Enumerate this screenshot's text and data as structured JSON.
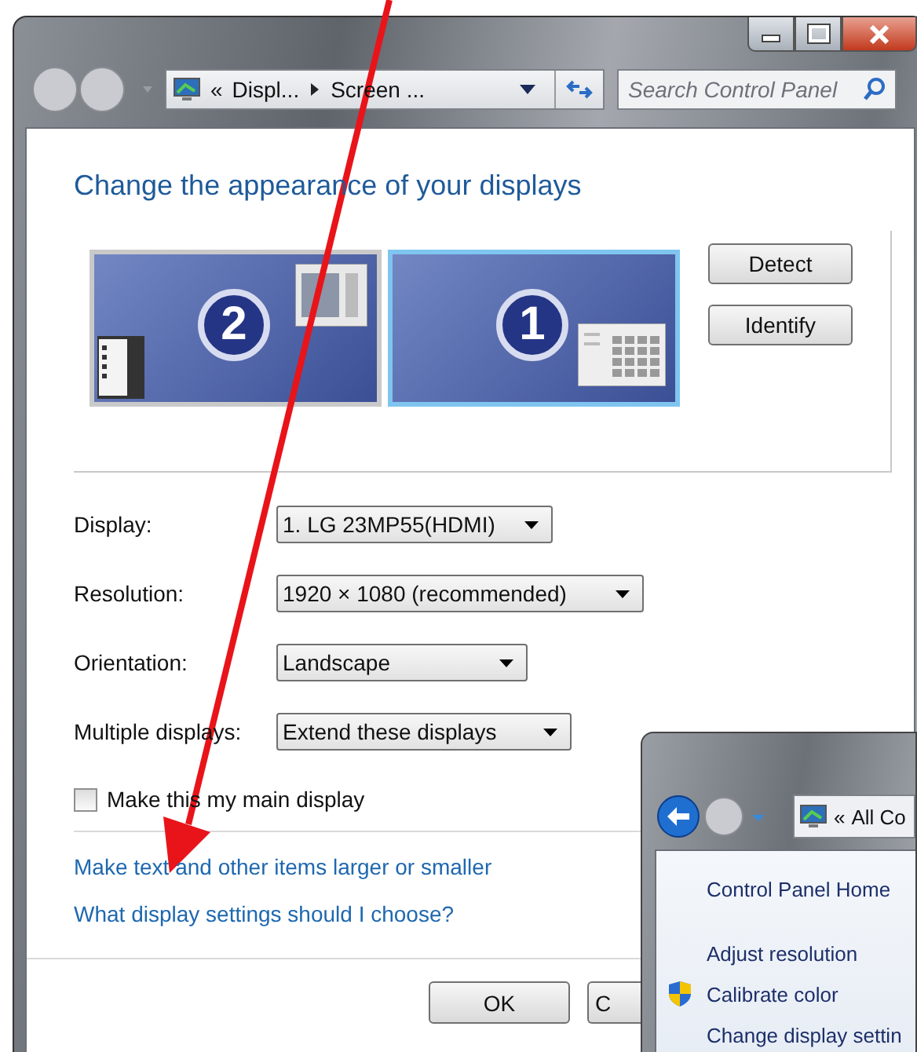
{
  "address_bar": {
    "prefix": "«",
    "segments": [
      "Displ...",
      "Screen ..."
    ]
  },
  "search": {
    "placeholder": "Search Control Panel"
  },
  "heading": "Change the appearance of your displays",
  "monitors": [
    {
      "number": "2",
      "selected": false
    },
    {
      "number": "1",
      "selected": true
    }
  ],
  "monitor_buttons": [
    "Detect",
    "Identify"
  ],
  "settings": [
    {
      "label": "Display:",
      "value": "1. LG 23MP55(HDMI)"
    },
    {
      "label": "Resolution:",
      "value": "1920 × 1080 (recommended)"
    },
    {
      "label": "Orientation:",
      "value": "Landscape"
    },
    {
      "label": "Multiple displays:",
      "value": "Extend these displays"
    }
  ],
  "main_display": {
    "label": "Make this my main display",
    "checked": false
  },
  "links": [
    "Make text and other items larger or smaller",
    "What display settings should I choose?"
  ],
  "footer_buttons": [
    "OK",
    "C"
  ],
  "second_window": {
    "address_bar": {
      "prefix": "«",
      "text": "All Co"
    },
    "nav_items": [
      {
        "label": "Control Panel Home",
        "kind": "plain"
      },
      {
        "label": "Adjust resolution",
        "kind": "plain"
      },
      {
        "label": "Calibrate color",
        "kind": "shield"
      },
      {
        "label": "Change display settin",
        "kind": "plain"
      }
    ]
  }
}
